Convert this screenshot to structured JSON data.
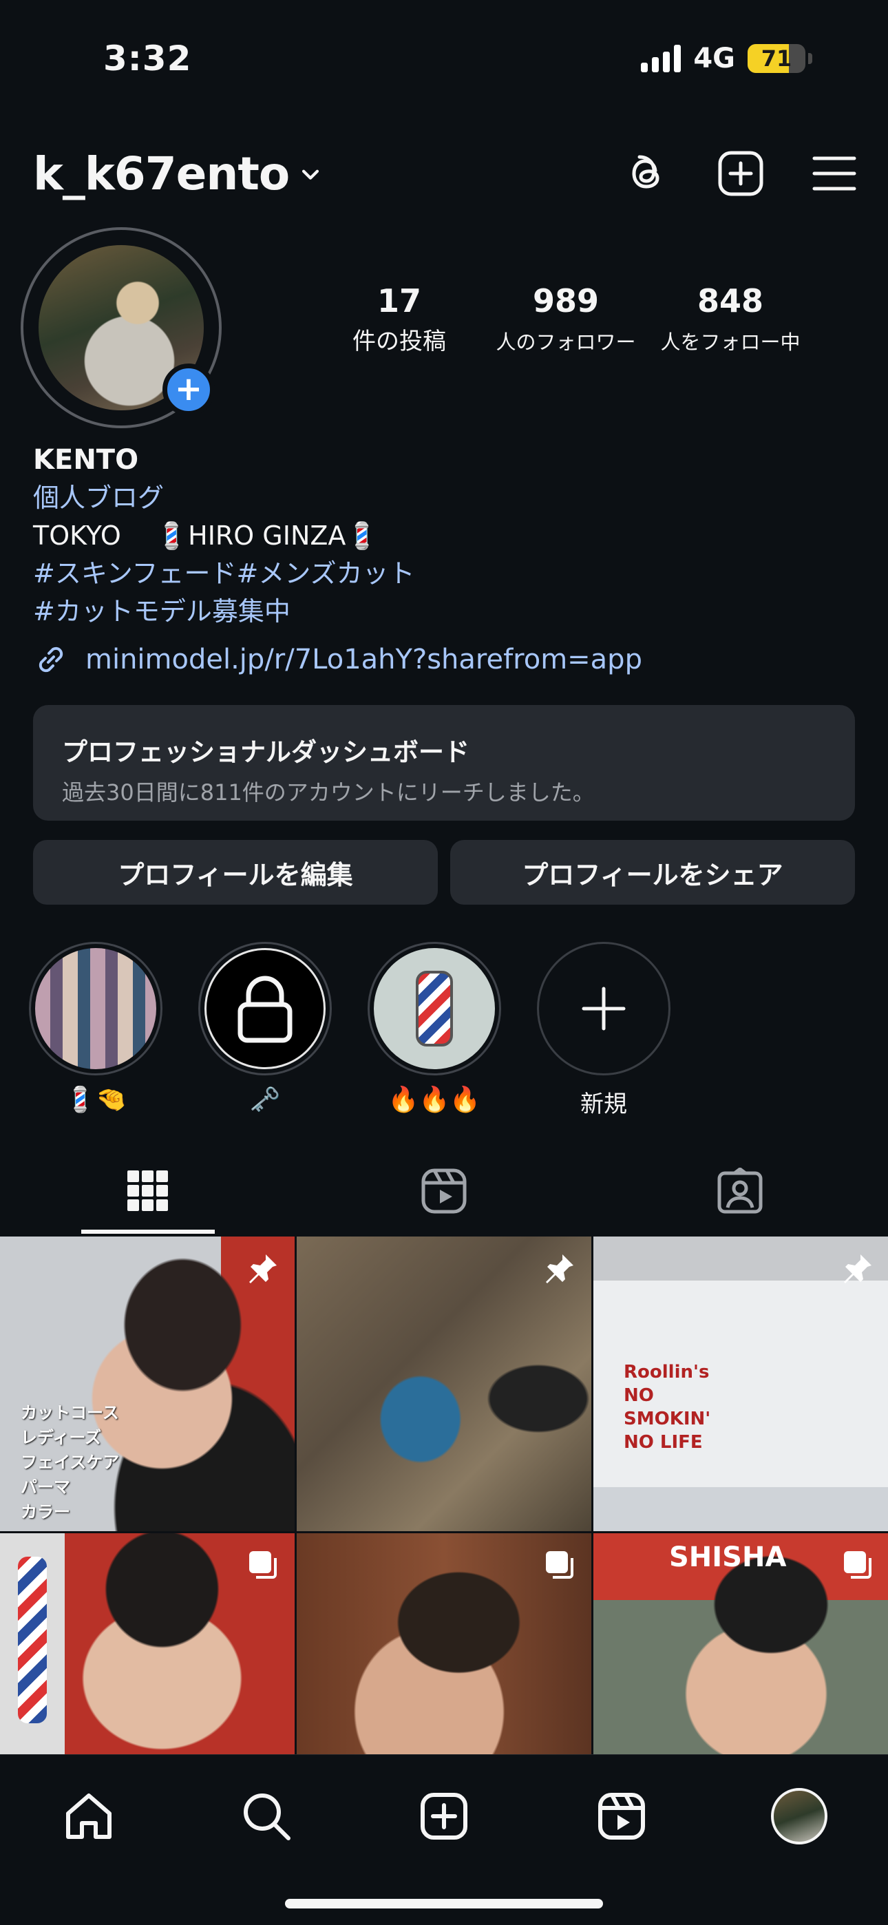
{
  "status_bar": {
    "time": "3:32",
    "network": "4G",
    "battery": "71",
    "battery_level": 0.71
  },
  "header": {
    "username": "k_k67ento"
  },
  "profile": {
    "posts_count": "17",
    "posts_label": "件の投稿",
    "followers_count": "989",
    "followers_label": "人のフォロワー",
    "following_count": "848",
    "following_label": "人をフォロー中"
  },
  "bio": {
    "name": "KENTO",
    "category": "個人ブログ",
    "line1": "TOKYO 　💈HIRO GINZA💈",
    "hashtags1": "#スキンフェード#メンズカット",
    "hashtags2": "#カットモデル募集中",
    "link": "minimodel.jp/r/7Lo1ahY?sharefrom=app"
  },
  "dashboard": {
    "title": "プロフェッショナルダッシュボード",
    "subtitle": "過去30日間に811件のアカウントにリーチしました。"
  },
  "buttons": {
    "edit": "プロフィールを編集",
    "share": "プロフィールをシェア"
  },
  "highlights": [
    {
      "label": "💈🤏"
    },
    {
      "label": "🗝️"
    },
    {
      "label": "🔥🔥🔥"
    },
    {
      "label": "新規"
    }
  ],
  "grid_texts": {
    "post1_lines": [
      "カットコース",
      "レディーズ",
      "フェイスケア",
      "パーマ",
      "カラー"
    ],
    "post3_left": "Roollin's NO SMOKIN' NO LIFE",
    "post5": "SHISHA"
  },
  "colors": {
    "background": "#0c1014",
    "accent_blue": "#3a8cf0",
    "link_blue": "#a8c7fa",
    "card": "#262a30"
  }
}
